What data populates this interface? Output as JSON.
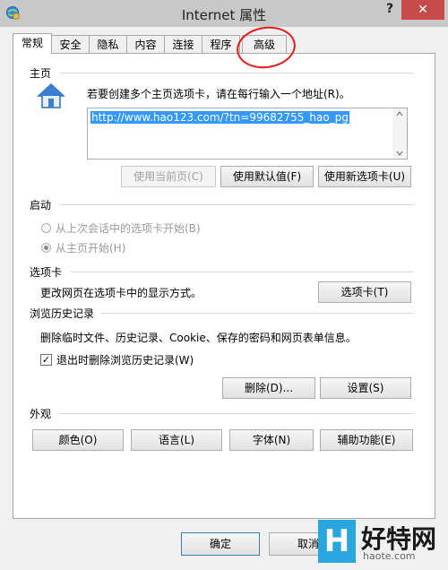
{
  "window": {
    "title": "Internet 属性",
    "help": "?",
    "close": "✕"
  },
  "tabs": [
    {
      "label": "常规"
    },
    {
      "label": "安全"
    },
    {
      "label": "隐私"
    },
    {
      "label": "内容"
    },
    {
      "label": "连接"
    },
    {
      "label": "程序"
    },
    {
      "label": "高级"
    }
  ],
  "home": {
    "section": "主页",
    "instruction": "若要创建多个主页选项卡，请在每行输入一个地址(R)。",
    "url": "http://www.hao123.com/?tn=99682755_hao_pg",
    "btn_current": "使用当前页(C)",
    "btn_default": "使用默认值(F)",
    "btn_newtab": "使用新选项卡(U)"
  },
  "startup": {
    "section": "启动",
    "option_last": "从上次会话中的选项卡开始(B)",
    "option_home": "从主页开始(H)"
  },
  "tabs_section": {
    "section": "选项卡",
    "desc": "更改网页在选项卡中的显示方式。",
    "btn": "选项卡(T)"
  },
  "history": {
    "section": "浏览历史记录",
    "desc": "删除临时文件、历史记录、Cookie、保存的密码和网页表单信息。",
    "checkbox_label": "退出时删除浏览历史记录(W)",
    "checkbox_mark": "✓",
    "btn_delete": "删除(D)...",
    "btn_settings": "设置(S)"
  },
  "appearance": {
    "section": "外观",
    "btn_colors": "颜色(O)",
    "btn_languages": "语言(L)",
    "btn_fonts": "字体(N)",
    "btn_accessibility": "辅助功能(E)"
  },
  "footer": {
    "ok": "确定",
    "cancel": "取消"
  },
  "watermark": {
    "letter": "H",
    "text": "好特网",
    "site": "haote.com"
  }
}
